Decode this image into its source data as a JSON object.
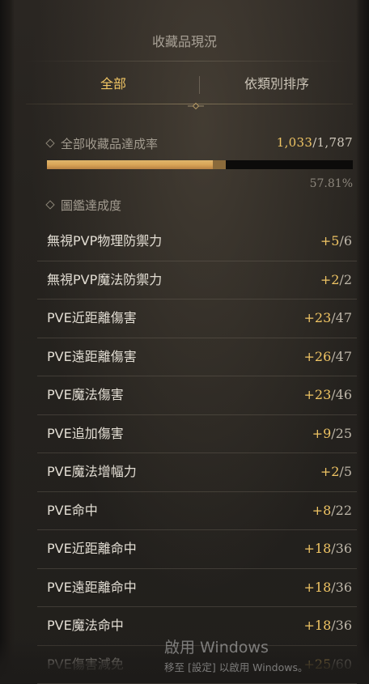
{
  "panel": {
    "title": "收藏品現況"
  },
  "tabs": [
    {
      "label": "全部",
      "active": true
    },
    {
      "label": "依類別排序",
      "active": false
    }
  ],
  "collection": {
    "label": "全部收藏品達成率",
    "current": "1,033",
    "total": "/1,787",
    "progress": 0.5781,
    "percent_text": "57.81%"
  },
  "codex": {
    "label": "圖鑑達成度"
  },
  "items": [
    {
      "name": "無視PVP物理防禦力",
      "gain": "+5",
      "max": "/6"
    },
    {
      "name": "無視PVP魔法防禦力",
      "gain": "+2",
      "max": "/2"
    },
    {
      "name": "PVE近距離傷害",
      "gain": "+23",
      "max": "/47"
    },
    {
      "name": "PVE遠距離傷害",
      "gain": "+26",
      "max": "/47"
    },
    {
      "name": "PVE魔法傷害",
      "gain": "+23",
      "max": "/46"
    },
    {
      "name": "PVE追加傷害",
      "gain": "+9",
      "max": "/25"
    },
    {
      "name": "PVE魔法增幅力",
      "gain": "+2",
      "max": "/5"
    },
    {
      "name": "PVE命中",
      "gain": "+8",
      "max": "/22"
    },
    {
      "name": "PVE近距離命中",
      "gain": "+18",
      "max": "/36"
    },
    {
      "name": "PVE遠距離命中",
      "gain": "+18",
      "max": "/36"
    },
    {
      "name": "PVE魔法命中",
      "gain": "+18",
      "max": "/36"
    },
    {
      "name": "PVE傷害減免",
      "gain": "+25",
      "max": "/60"
    }
  ],
  "watermark": {
    "title": "啟用 Windows",
    "subtitle": "移至 [設定] 以啟用 Windows。"
  },
  "colors": {
    "accent": "#f0c564",
    "bar": "#d9a557"
  }
}
